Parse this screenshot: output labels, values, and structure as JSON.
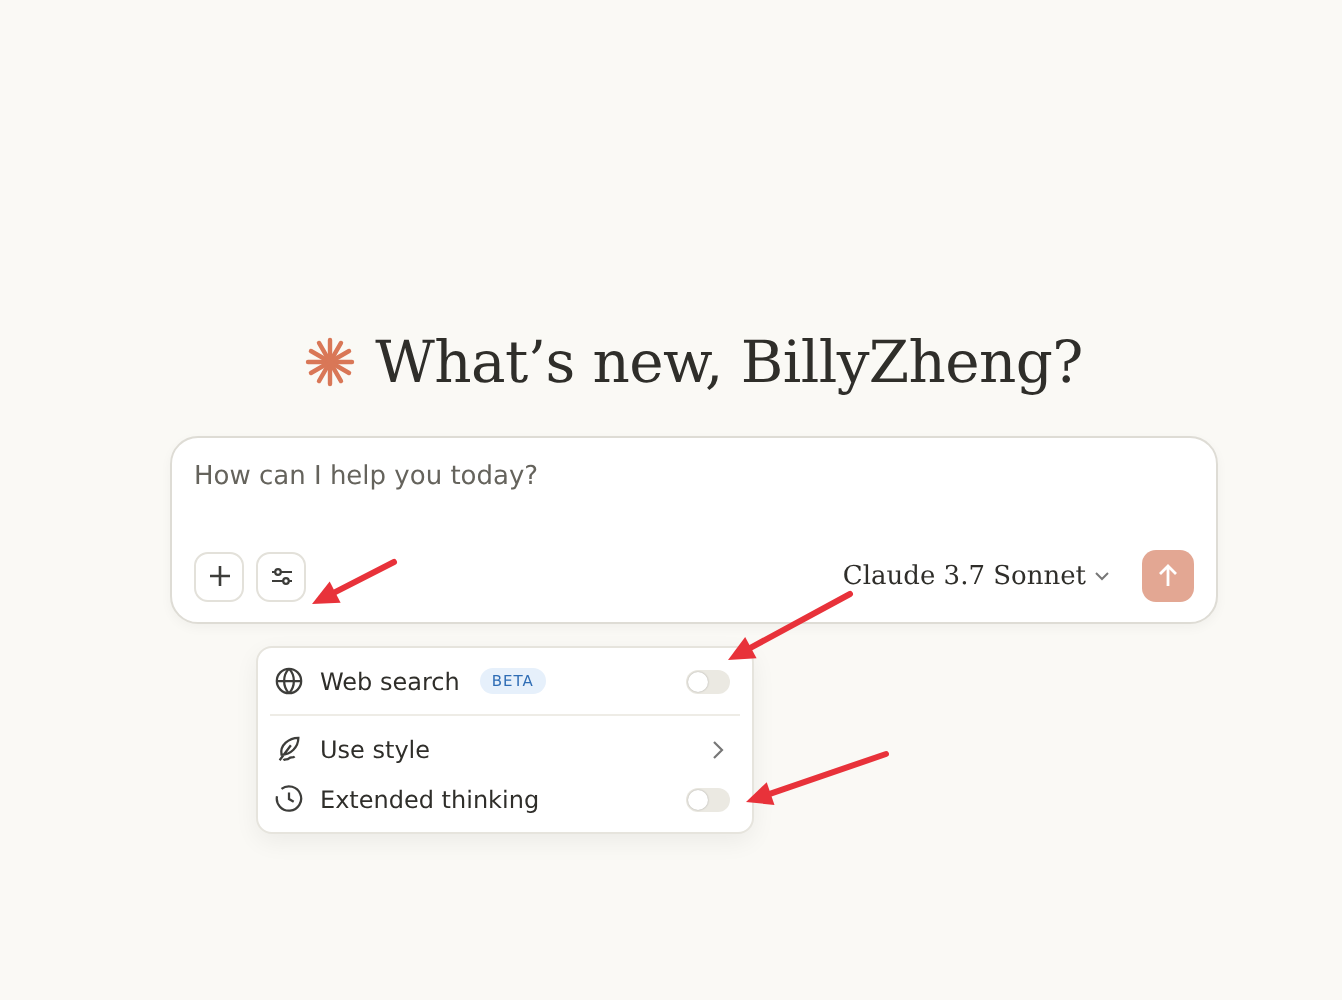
{
  "greeting": {
    "title": "What’s new, BillyZheng?"
  },
  "composer": {
    "placeholder": "How can I help you today?",
    "model": "Claude 3.7 Sonnet"
  },
  "tools_menu": {
    "items": [
      {
        "kind": "toggle",
        "label": "Web search",
        "badge": "BETA",
        "on": false
      },
      {
        "kind": "submenu",
        "label": "Use style"
      },
      {
        "kind": "toggle",
        "label": "Extended thinking",
        "on": false
      }
    ]
  }
}
